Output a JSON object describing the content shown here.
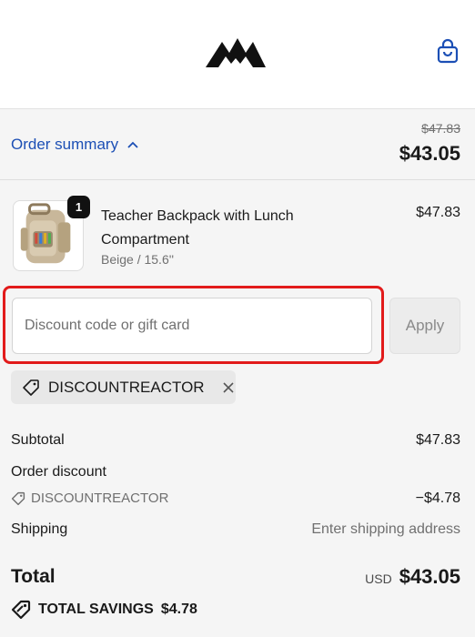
{
  "header": {
    "logo_icon": "mountain-logo-icon",
    "cart_icon": "shopping-bag-icon"
  },
  "summary": {
    "toggle_label": "Order summary",
    "original_price": "$47.83",
    "current_price": "$43.05"
  },
  "product": {
    "quantity": "1",
    "name": "Teacher Backpack with Lunch Compartment",
    "variant": "Beige / 15.6''",
    "price": "$47.83"
  },
  "discount": {
    "placeholder": "Discount code or gift card",
    "apply_label": "Apply",
    "applied_code": "DISCOUNTREACTOR"
  },
  "totals": {
    "subtotal_label": "Subtotal",
    "subtotal_value": "$47.83",
    "order_discount_label": "Order discount",
    "discount_code": "DISCOUNTREACTOR",
    "discount_value": "−$4.78",
    "shipping_label": "Shipping",
    "shipping_value": "Enter shipping address",
    "total_label": "Total",
    "currency": "USD",
    "total_value": "$43.05",
    "savings_label": "TOTAL SAVINGS",
    "savings_value": "$4.78"
  },
  "colors": {
    "link": "#1c4fb5",
    "highlight": "#e21b1b"
  }
}
